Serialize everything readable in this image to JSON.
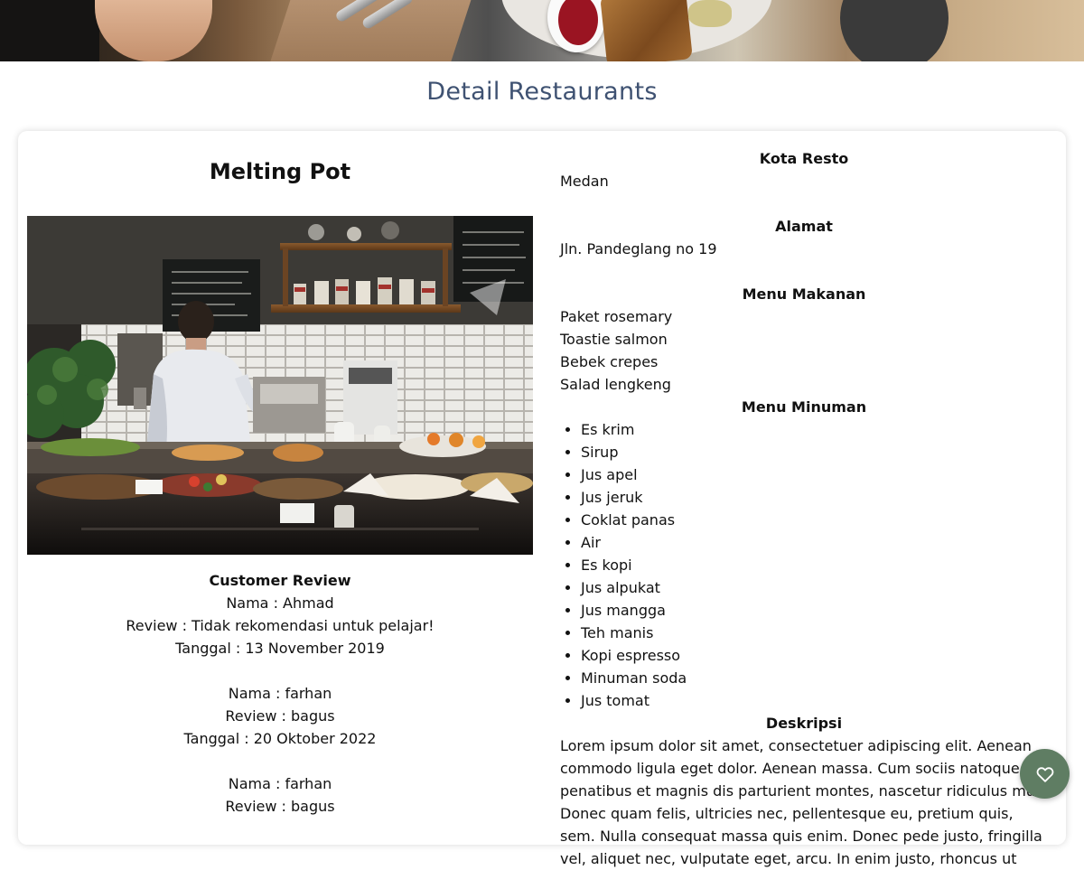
{
  "page": {
    "section_title": "Detail Restaurants"
  },
  "restaurant": {
    "name": "Melting Pot",
    "photo_alt": "Restaurant kitchen"
  },
  "reviews": {
    "heading": "Customer Review",
    "items": [
      {
        "nama": "Nama : Ahmad",
        "review": "Review : Tidak rekomendasi untuk pelajar!",
        "tanggal": "Tanggal : 13 November 2019"
      },
      {
        "nama": "Nama : farhan",
        "review": "Review : bagus",
        "tanggal": "Tanggal : 20 Oktober 2022"
      },
      {
        "nama": "Nama : farhan",
        "review": "Review : bagus",
        "tanggal": ""
      }
    ]
  },
  "details": {
    "kota_label": "Kota Resto",
    "kota": "Medan",
    "alamat_label": "Alamat",
    "alamat": "Jln. Pandeglang no 19",
    "makanan_label": "Menu Makanan",
    "makanan": [
      "Paket rosemary",
      "Toastie salmon",
      "Bebek crepes",
      "Salad lengkeng"
    ],
    "minuman_label": "Menu Minuman",
    "minuman": [
      "Es krim",
      "Sirup",
      "Jus apel",
      "Jus jeruk",
      "Coklat panas",
      "Air",
      "Es kopi",
      "Jus alpukat",
      "Jus mangga",
      "Teh manis",
      "Kopi espresso",
      "Minuman soda",
      "Jus tomat"
    ],
    "deskripsi_label": "Deskripsi",
    "deskripsi": "Lorem ipsum dolor sit amet, consectetuer adipiscing elit. Aenean commodo ligula eget dolor. Aenean massa. Cum sociis natoque penatibus et magnis dis parturient montes, nascetur ridiculus mus. Donec quam felis, ultricies nec, pellentesque eu, pretium quis, sem. Nulla consequat massa quis enim. Donec pede justo, fringilla vel, aliquet nec, vulputate eget, arcu. In enim justo, rhoncus ut"
  },
  "favorite_button": {
    "icon": "heart-icon",
    "color": "#5f7d63"
  }
}
